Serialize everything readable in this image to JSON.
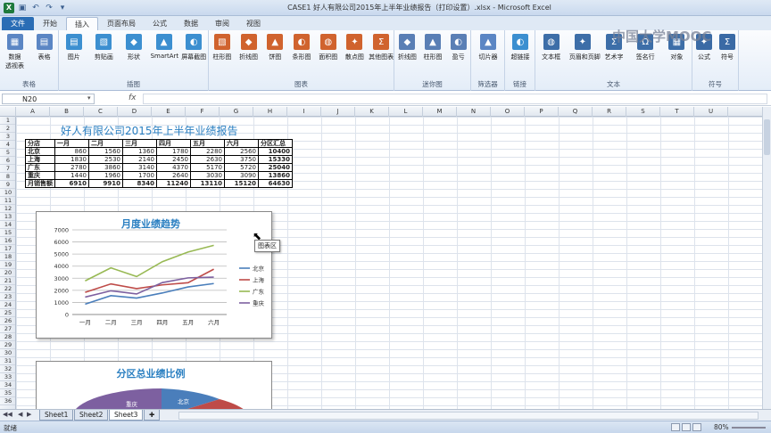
{
  "window": {
    "title": "CASE1 好人有限公司2015年上半年业绩报告（打印设置）.xlsx - Microsoft Excel"
  },
  "tabs": [
    "文件",
    "开始",
    "插入",
    "页面布局",
    "公式",
    "数据",
    "审阅",
    "视图"
  ],
  "active_tab": "插入",
  "ribbon": {
    "groups": [
      {
        "label": "表格",
        "buttons": [
          "数据\n透视表",
          "表格"
        ]
      },
      {
        "label": "插图",
        "buttons": [
          "图片",
          "剪贴画",
          "形状",
          "SmartArt",
          "屏幕截图"
        ]
      },
      {
        "label": "图表",
        "buttons": [
          "柱形图",
          "折线图",
          "饼图",
          "条形图",
          "面积图",
          "散点图",
          "其他图表"
        ]
      },
      {
        "label": "迷你图",
        "buttons": [
          "折线图",
          "柱形图",
          "盈亏"
        ]
      },
      {
        "label": "筛选器",
        "buttons": [
          "切片器"
        ]
      },
      {
        "label": "链接",
        "buttons": [
          "超链接"
        ]
      },
      {
        "label": "文本",
        "buttons": [
          "文本框",
          "页眉和页脚",
          "艺术字",
          "签名行",
          "对象"
        ]
      },
      {
        "label": "符号",
        "buttons": [
          "公式",
          "符号"
        ]
      }
    ],
    "icon_colors": {
      "table": "#5b86c4",
      "picture": "#3c8fd0",
      "chart": "#d0632e",
      "sparkline": "#5a7fb5",
      "text": "#3d6ea8",
      "symbol": "#3a6aa5"
    }
  },
  "watermark": "中国大学MOOC",
  "formula_bar": {
    "name_box": "N20",
    "fx": "fx",
    "content": ""
  },
  "columns": [
    "A",
    "B",
    "C",
    "D",
    "E",
    "F",
    "G",
    "H",
    "I",
    "J",
    "K",
    "L",
    "M",
    "N",
    "O",
    "P",
    "Q",
    "R",
    "S",
    "T",
    "U"
  ],
  "rows": [
    "1",
    "2",
    "3",
    "4",
    "5",
    "6",
    "7",
    "8",
    "9",
    "10",
    "11",
    "12",
    "13",
    "14",
    "15",
    "16",
    "17",
    "18",
    "19",
    "20",
    "21",
    "22",
    "23",
    "24",
    "25",
    "26",
    "27",
    "28",
    "29",
    "30",
    "31",
    "32",
    "33",
    "34",
    "35",
    "36"
  ],
  "report": {
    "title": "好人有限公司2015年上半年业绩报告",
    "headers": [
      "分店",
      "一月",
      "二月",
      "三月",
      "四月",
      "五月",
      "六月",
      "分区汇总"
    ],
    "rows": [
      [
        "北京",
        "860",
        "1560",
        "1360",
        "1780",
        "2280",
        "2560",
        "10400"
      ],
      [
        "上海",
        "1830",
        "2530",
        "2140",
        "2450",
        "2630",
        "3750",
        "15330"
      ],
      [
        "广东",
        "2780",
        "3860",
        "3140",
        "4370",
        "5170",
        "5720",
        "25040"
      ],
      [
        "重庆",
        "1440",
        "1960",
        "1700",
        "2640",
        "3030",
        "3090",
        "13860"
      ],
      [
        "月销售额",
        "6910",
        "9910",
        "8340",
        "11240",
        "13110",
        "15120",
        "64630"
      ]
    ]
  },
  "chart_data": [
    {
      "type": "line",
      "title": "月度业绩趋势",
      "categories": [
        "一月",
        "二月",
        "三月",
        "四月",
        "五月",
        "六月"
      ],
      "ylim": [
        0,
        7000
      ],
      "yticks": [
        "0",
        "1000",
        "2000",
        "3000",
        "4000",
        "5000",
        "6000",
        "7000"
      ],
      "grid": true,
      "legend": "right",
      "series": [
        {
          "name": "北京",
          "values": [
            860,
            1560,
            1360,
            1780,
            2280,
            2560
          ],
          "color": "#4a7ebb"
        },
        {
          "name": "上海",
          "values": [
            1830,
            2530,
            2140,
            2450,
            2630,
            3750
          ],
          "color": "#be4b48"
        },
        {
          "name": "广东",
          "values": [
            2780,
            3860,
            3140,
            4370,
            5170,
            5720
          ],
          "color": "#98b954"
        },
        {
          "name": "重庆",
          "values": [
            1440,
            1960,
            1700,
            2640,
            3030,
            3090
          ],
          "color": "#7d60a0"
        }
      ]
    },
    {
      "type": "pie",
      "title": "分区总业绩比例",
      "labels": [
        "重庆",
        "北京"
      ],
      "colors": [
        "#7d60a0",
        "#4a7ebb",
        "#be4b48",
        "#98b954"
      ]
    }
  ],
  "chart_tooltip": "图表区",
  "sheets": [
    "Sheet1",
    "Sheet2",
    "Sheet3"
  ],
  "active_sheet": "Sheet3",
  "status": {
    "text": "就绪",
    "zoom": "80%"
  }
}
